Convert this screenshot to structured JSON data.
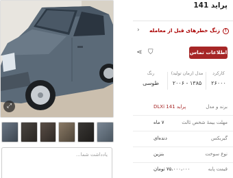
{
  "listing": {
    "title": "پراید 141",
    "warning": "زنگ خطرهای قبل از معامله",
    "contact_button": "اطلاعات تماس",
    "note_placeholder": "یادداشت شما...",
    "specs": [
      {
        "label": "کارکرد",
        "value": "۲۶۰۰۰"
      },
      {
        "label": "مدل (زمان تولید)",
        "value": "۱۳۸۵ - ۲۰۰۶"
      },
      {
        "label": "رنگ",
        "value": "طوسی"
      }
    ],
    "details": [
      {
        "key": "برند و مدل",
        "value": "پراید 141 DLXi"
      },
      {
        "key": "مهلت بیمهٔ شخص ثالث",
        "value": "۷ ماه"
      },
      {
        "key": "گیربکس",
        "value": "دنده‌ای"
      },
      {
        "key": "نوع سوخت",
        "value": "بنزین"
      },
      {
        "key": "قیمت پایه",
        "value": "۷۵،۰۰۰،۰۰۰ تومان"
      }
    ]
  },
  "icons": {
    "expand": "expand-icon",
    "warning": "alert-icon",
    "chevron": "chevron-left-icon",
    "share": "share-icon",
    "bookmark": "bookmark-icon"
  },
  "colors": {
    "accent": "#a62626",
    "car_body": "#5b6a78"
  }
}
